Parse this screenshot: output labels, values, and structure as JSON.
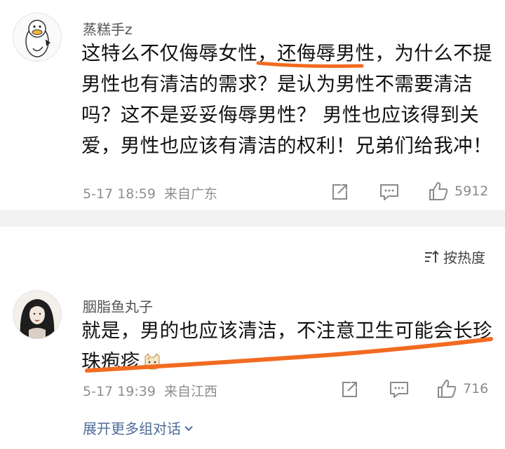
{
  "comment1": {
    "username": "蒸糕手z",
    "lines": [
      "这特么不仅侮辱女性，还侮辱男性，为什么不提",
      "男性也有清洁的需求？是认为男性不需要清洁",
      "吗？这不是妥妥侮辱男性？ 男性也应该得到关",
      "爱，男性也应该有清洁的权利！兄弟们给我冲！"
    ],
    "timestamp": "5-17 18:59",
    "location": "来自广东",
    "like_count": "5912",
    "icons": [
      "share-icon",
      "comment-icon",
      "like-icon"
    ]
  },
  "comment2": {
    "username": "胭脂鱼丸子",
    "lines": [
      "就是，男的也应该清洁，不注意卫生可能会长珍",
      "珠疱疹"
    ],
    "timestamp": "5-17 19:39",
    "location": "来自江西",
    "like_count": "716",
    "icons": [
      "share-icon",
      "comment-icon",
      "like-icon"
    ]
  },
  "sort": {
    "label": "按热度",
    "icon": "sort-icon"
  },
  "expand": {
    "label": "展开更多组对话",
    "icon": "chevron-down-icon"
  },
  "colors": {
    "annotation": "#f26b21",
    "link": "#4f6d99",
    "meta": "#8e8e8e",
    "separator": "#f2f2f2"
  }
}
